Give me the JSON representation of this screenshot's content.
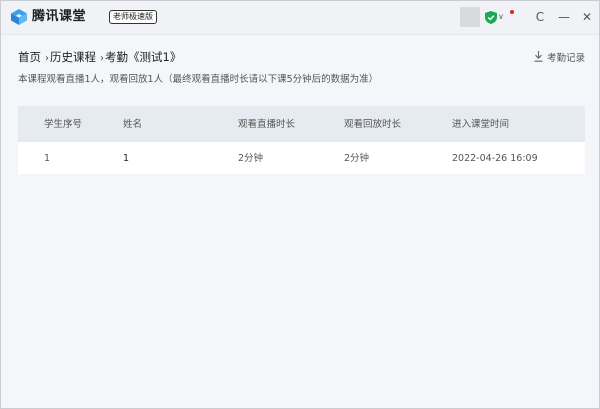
{
  "app": {
    "name": "腾讯课堂",
    "edition": "老师极速版"
  },
  "titlebar": {
    "icons": [
      "logo-icon",
      "avatar",
      "shield-icon",
      "chevron-down-icon",
      "refresh-icon",
      "minimize-icon",
      "close-icon"
    ],
    "refresh_glyph": "C",
    "minimize_glyph": "—",
    "close_glyph": "✕",
    "dropdown_glyph": "∨"
  },
  "breadcrumb": {
    "items": [
      "首页",
      "历史课程",
      "考勤《测试1》"
    ],
    "separator": "›"
  },
  "export": {
    "label": "考勤记录",
    "icon": "download-icon"
  },
  "summary": "本课程观看直播1人，观看回放1人（最终观看直播时长请以下课5分钟后的数据为准）",
  "table": {
    "columns": [
      "学生序号",
      "姓名",
      "观看直播时长",
      "观看回放时长",
      "进入课堂时间"
    ],
    "rows": [
      [
        "1",
        "1",
        "2分钟",
        "2分钟",
        "2022-04-26 16:09"
      ]
    ]
  },
  "colors": {
    "accent": "#1aaa55",
    "logo": "#2b9cf2",
    "header_bg": "#e6ebf1",
    "notify": "#e02020"
  }
}
